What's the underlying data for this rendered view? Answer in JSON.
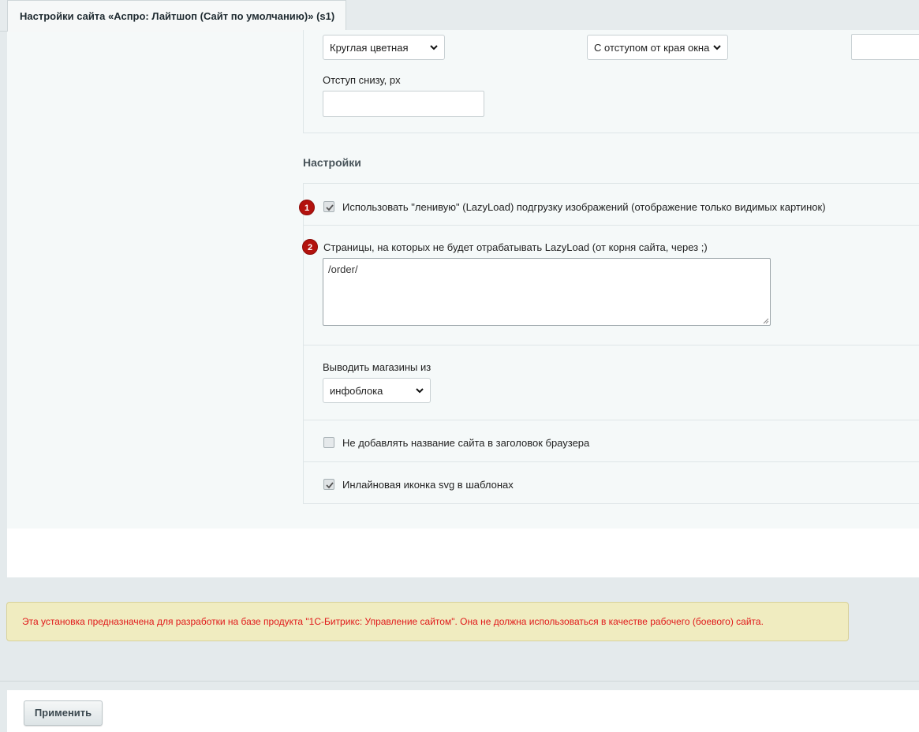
{
  "tab": {
    "title": "Настройки сайта «Аспро: Лайтшоп (Сайт по умолчанию)» (s1)"
  },
  "top_fields": {
    "select1_value": "Круглая цветная",
    "select2_value": "С отступом от края окна",
    "bottom_offset_label": "Отступ снизу, px",
    "bottom_offset_value": "",
    "right_input_value": ""
  },
  "settings": {
    "title": "Настройки",
    "lazyload": {
      "badge": "1",
      "label": "Использовать \"ленивую\" (LazyLoad) подгрузку изображений (отображение только видимых картинок)",
      "checked": true
    },
    "lazyload_pages": {
      "badge": "2",
      "label": "Страницы, на которых не будет отрабатывать LazyLoad (от корня сайта, через ;)",
      "value": "/order/"
    },
    "stores": {
      "label": "Выводить магазины из",
      "value": "инфоблока"
    },
    "no_site_title": {
      "label": "Не добавлять название сайта в заголовок браузера",
      "checked": false
    },
    "inline_svg": {
      "label": "Инлайновая иконка svg в шаблонах",
      "checked": true
    }
  },
  "warning": {
    "text": "Эта установка предназначена для разработки на базе продукта \"1С-Битрикс: Управление сайтом\". Она не должна использоваться в качестве рабочего (боевого) сайта.",
    "color": "#e0191a"
  },
  "footer": {
    "apply_label": "Применить"
  }
}
